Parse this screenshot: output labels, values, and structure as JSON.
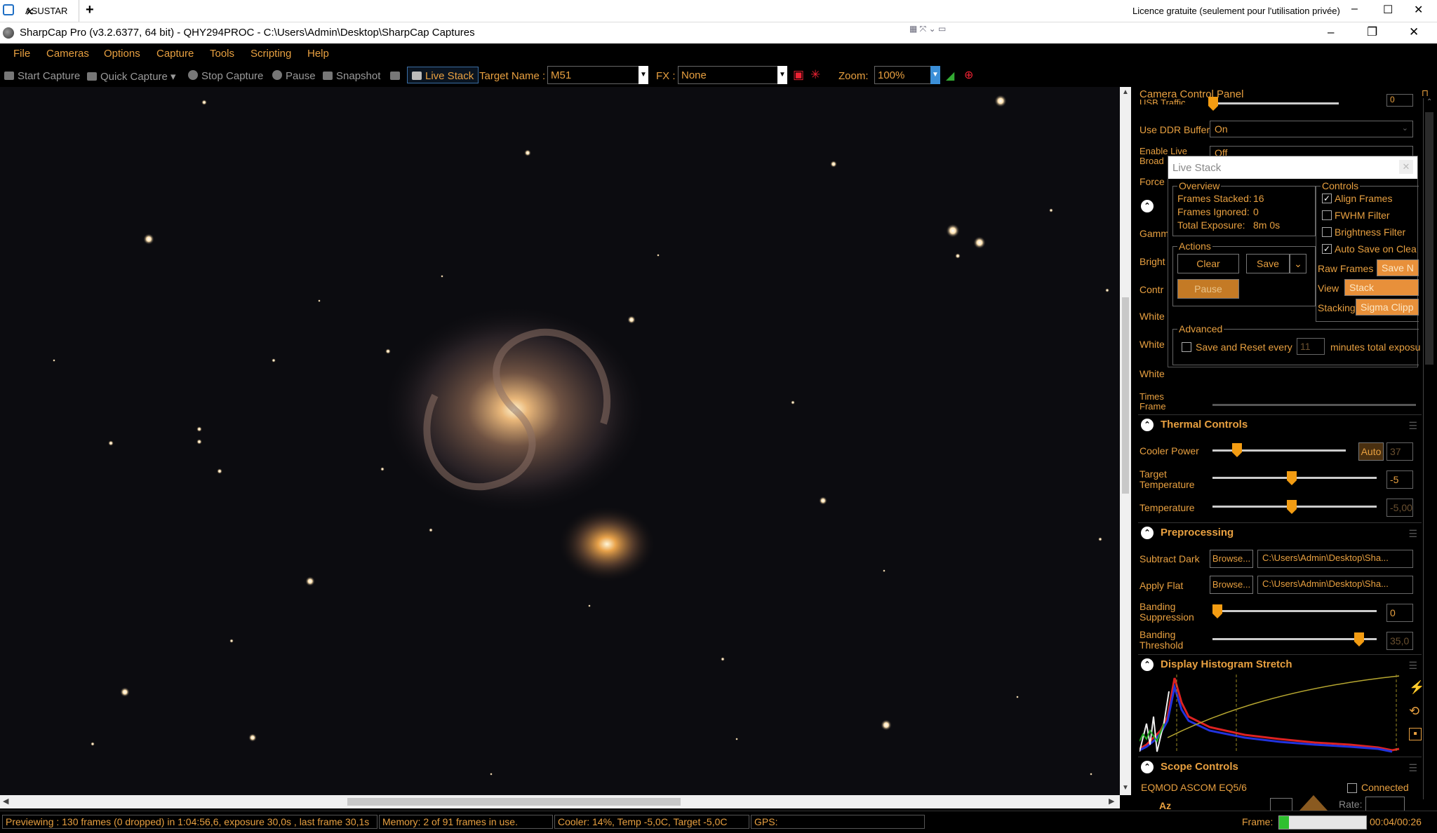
{
  "remote": {
    "tab_label": "ASUSTAR",
    "license": "Licence gratuite (seulement pour l'utilisation privée)"
  },
  "window": {
    "title": "SharpCap Pro (v3.2.6377, 64 bit) - QHY294PROC - C:\\Users\\Admin\\Desktop\\SharpCap Captures"
  },
  "menu": [
    "File",
    "Cameras",
    "Options",
    "Capture",
    "Tools",
    "Scripting",
    "Help"
  ],
  "toolbar": {
    "start_capture": "Start Capture",
    "quick_capture": "Quick Capture",
    "stop_capture": "Stop Capture",
    "pause": "Pause",
    "snapshot": "Snapshot",
    "live_stack": "Live Stack",
    "target_label": "Target Name :",
    "target_value": "M51",
    "fx_label": "FX :",
    "fx_value": "None",
    "zoom_label": "Zoom:",
    "zoom_value": "100%"
  },
  "status": {
    "preview": "Previewing : 130 frames (0 dropped) in 1:04:56,6, exposure 30,0s , last frame 30,1s",
    "memory": "Memory: 2 of 91 frames in use.",
    "cooler": "Cooler: 14%, Temp -5,0C, Target -5,0C",
    "gps": "GPS:",
    "frame_label": "Frame:",
    "frame_time": "00:04/00:26"
  },
  "panel": {
    "title": "Camera Control Panel",
    "usb_traffic": "USB Traffic",
    "usb_value": "0",
    "ddr_label": "Use DDR Buffer",
    "ddr_value": "On",
    "enable_live": "Enable Live",
    "broad": "Broad",
    "off": "Off",
    "force": "Force",
    "gamma": "Gamm",
    "bright": "Bright",
    "contr": "Contr",
    "white1": "White",
    "white2": "White",
    "white3": "White",
    "timestamp": "Times",
    "frame": "Frame",
    "thermal": {
      "title": "Thermal Controls",
      "cooler_power": "Cooler Power",
      "auto": "Auto",
      "cooler_value": "37",
      "target_temp": "Target Temperature",
      "target_value": "-5",
      "temperature": "Temperature",
      "temp_value": "-5,00"
    },
    "preprocessing": {
      "title": "Preprocessing",
      "subtract_dark": "Subtract Dark",
      "apply_flat": "Apply Flat",
      "browse": "Browse...",
      "dark_path": "C:\\Users\\Admin\\Desktop\\Sha...",
      "flat_path": "C:\\Users\\Admin\\Desktop\\Sha...",
      "banding_supp": "Banding Suppression",
      "banding_supp_value": "0",
      "banding_thresh": "Banding Threshold",
      "banding_thresh_value": "35,0"
    },
    "histogram": {
      "title": "Display Histogram Stretch"
    },
    "scope": {
      "title": "Scope Controls",
      "mount": "EQMOD ASCOM EQ5/6",
      "connected": "Connected",
      "az": "Az",
      "rate": "Rate:"
    }
  },
  "livestack": {
    "title": "Live Stack",
    "overview": "Overview",
    "frames_stacked": "Frames Stacked:",
    "frames_stacked_value": "16",
    "frames_ignored": "Frames Ignored:",
    "frames_ignored_value": "0",
    "total_exposure": "Total Exposure:",
    "total_exposure_value": "8m 0s",
    "actions": "Actions",
    "clear": "Clear",
    "save": "Save",
    "pause": "Pause",
    "controls": "Controls",
    "align": "Align Frames",
    "fwhm": "FWHM Filter",
    "brightness": "Brightness Filter",
    "autosave": "Auto Save on Clea",
    "raw_frames": "Raw Frames",
    "raw_frames_value": "Save N",
    "view": "View",
    "view_value": "Stack",
    "stacking": "Stacking",
    "stacking_value": "Sigma Clipp",
    "advanced": "Advanced",
    "save_reset": "Save and Reset every",
    "minutes_value": "11",
    "minutes_tail": "minutes total exposu"
  }
}
